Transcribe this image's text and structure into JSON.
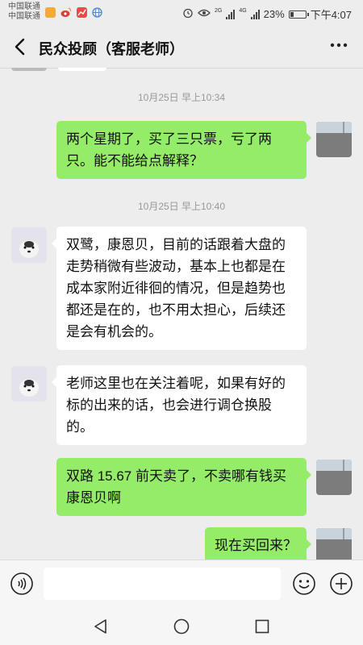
{
  "status_bar": {
    "carrier_1": "中国联通",
    "carrier_2": "中国联通",
    "network_tag_1": "2G",
    "network_tag_2": "4G",
    "battery_percent": "23%",
    "battery_level": 0.23,
    "time": "下午4:07",
    "icons": [
      "alarm-icon",
      "eye-icon",
      "signal-icon",
      "battery-icon"
    ],
    "app_icons": [
      "weibo-icon",
      "stock-app-icon",
      "browser-icon"
    ]
  },
  "header": {
    "title": "民众投顾（客服老师）",
    "back_icon": "chevron-left-icon",
    "more_icon": "more-dots-icon"
  },
  "messages": [
    {
      "type": "timestamp",
      "text": "10月25日 早上10:34"
    },
    {
      "type": "out",
      "sender": "me",
      "text": "两个星期了，买了三只票，亏了两只。能不能给点解释？"
    },
    {
      "type": "timestamp",
      "text": "10月25日 早上10:40"
    },
    {
      "type": "in",
      "sender": "teacher",
      "text": "双鹭，康恩贝，目前的话跟着大盘的走势稍微有些波动，基本上也都是在成本家附近徘徊的情况，但是趋势也都还是在的，也不用太担心，后续还是会有机会的。"
    },
    {
      "type": "in",
      "sender": "teacher",
      "text": "老师这里也在关注着呢，如果有好的标的出来的话，也会进行调仓换股的。"
    },
    {
      "type": "out",
      "sender": "me",
      "text": "双路 15.67 前天卖了，不卖哪有钱买康恩贝啊"
    },
    {
      "type": "out",
      "sender": "me",
      "text": "现在买回来？"
    }
  ],
  "input_bar": {
    "value": "",
    "placeholder": "",
    "voice_icon": "voice-icon",
    "emoji_icon": "emoji-icon",
    "plus_icon": "plus-icon"
  },
  "nav_bar": {
    "icons": [
      "nav-back-icon",
      "nav-home-icon",
      "nav-recent-icon"
    ]
  },
  "colors": {
    "background": "#ededed",
    "bubble_out": "#95ec69",
    "bubble_in": "#ffffff",
    "timestamp": "#999999"
  }
}
